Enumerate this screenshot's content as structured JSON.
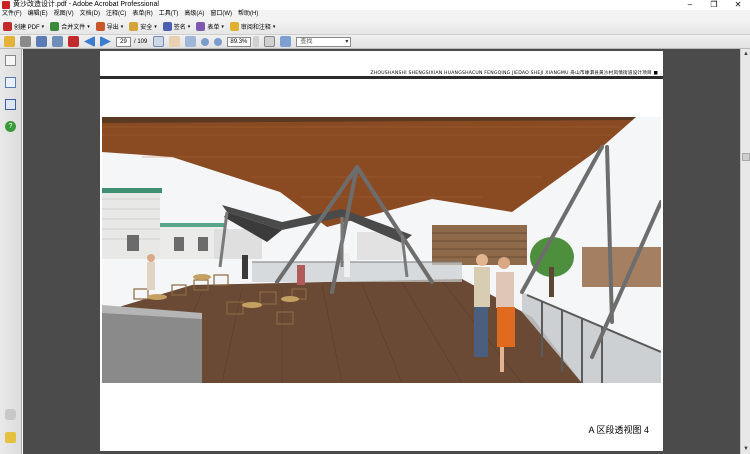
{
  "window": {
    "title": "黄沙改造设计.pdf - Adobe Acrobat Professional",
    "controls": [
      "–",
      "❐",
      "✕"
    ]
  },
  "menu": [
    "文件(F)",
    "编辑(E)",
    "视图(V)",
    "文档(D)",
    "注释(C)",
    "表单(R)",
    "工具(T)",
    "高级(A)",
    "窗口(W)",
    "帮助(H)"
  ],
  "toolbar1": {
    "create_pdf": "创建 PDF",
    "combine": "合并文件",
    "export": "导出",
    "secure": "安全",
    "sign": "签名",
    "forms": "表单",
    "review": "审阅和注释"
  },
  "toolbar2": {
    "current_page": "29",
    "total_pages": "/ 109",
    "zoom": "89.3%",
    "search_placeholder": "查找"
  },
  "document": {
    "header_text": "ZHOUSHANSHI SHENGSIXIAN HUANGSHACUN FENGQING JIEDAO SHEJI XIANGMU 舟山市嵊泗县黄沙村风情街道设计项目",
    "caption": "A 区段透视图 4"
  },
  "colors": {
    "canopy_wood": "#8a4b22",
    "deck": "#6b4a35",
    "accent_red": "#c22b2b"
  }
}
